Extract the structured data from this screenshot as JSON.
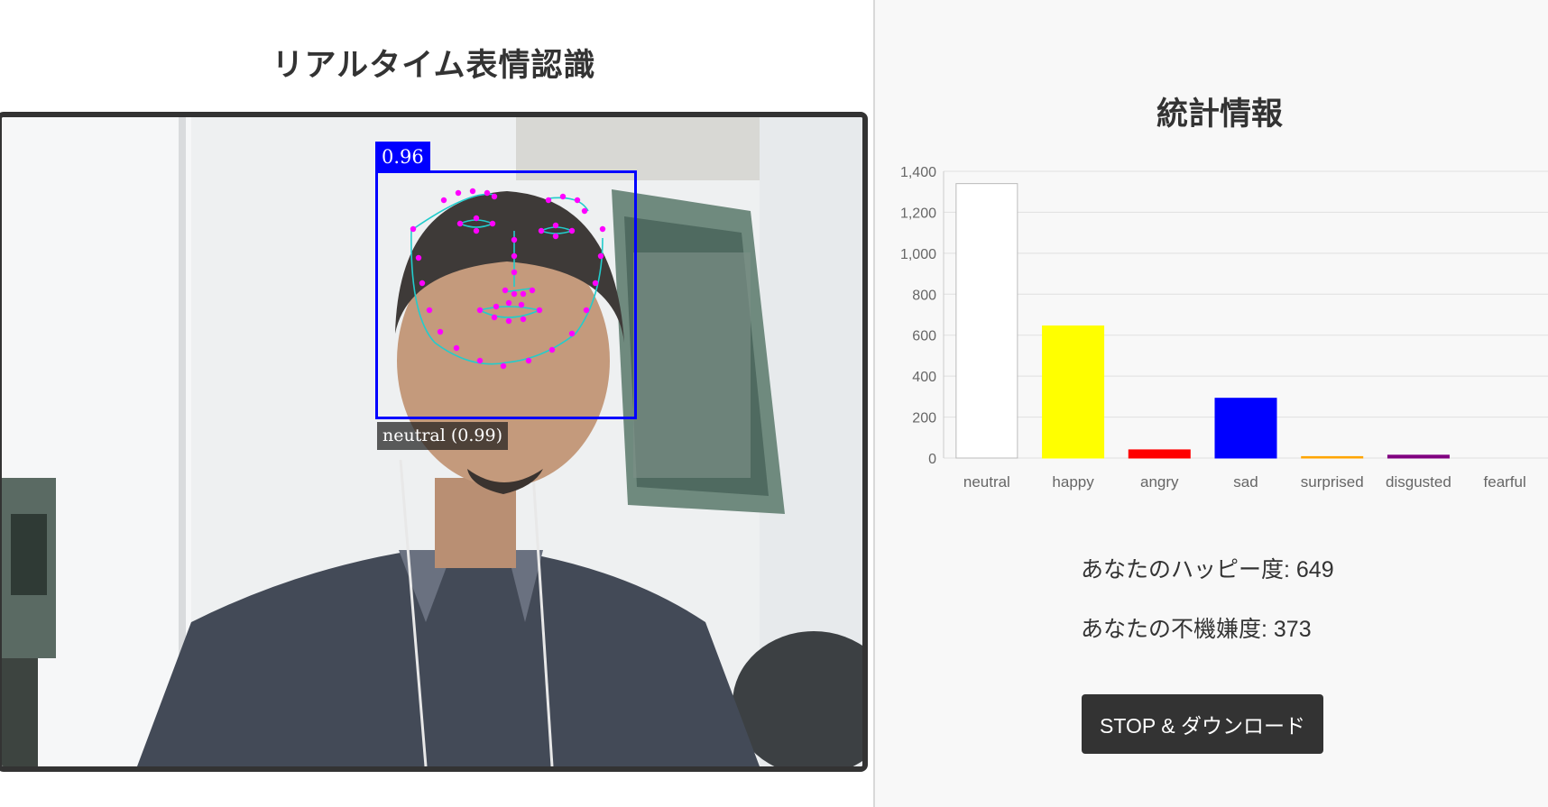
{
  "camera": {
    "title": "リアルタイム表情認識",
    "detection_score": "0.96",
    "expression_label": "neutral (0.99)"
  },
  "stats": {
    "title": "統計情報",
    "happy_line": "あなたのハッピー度: 649",
    "unhappy_line": "あなたの不機嫌度: 373",
    "stop_button_label": "STOP & ダウンロード"
  },
  "chart_data": {
    "type": "bar",
    "categories": [
      "neutral",
      "happy",
      "angry",
      "sad",
      "surprised",
      "disgusted",
      "fearful"
    ],
    "values": [
      1340,
      645,
      40,
      292,
      7,
      14,
      0
    ],
    "colors": [
      "#ffffff",
      "#ffff00",
      "#ff0000",
      "#0000ff",
      "#ffa500",
      "#800080",
      "#808080"
    ],
    "ylim": [
      0,
      1400
    ],
    "yticks": [
      "0",
      "200",
      "400",
      "600",
      "800",
      "1,000",
      "1,200",
      "1,400"
    ],
    "grid": true,
    "title": "",
    "xlabel": "",
    "ylabel": ""
  }
}
